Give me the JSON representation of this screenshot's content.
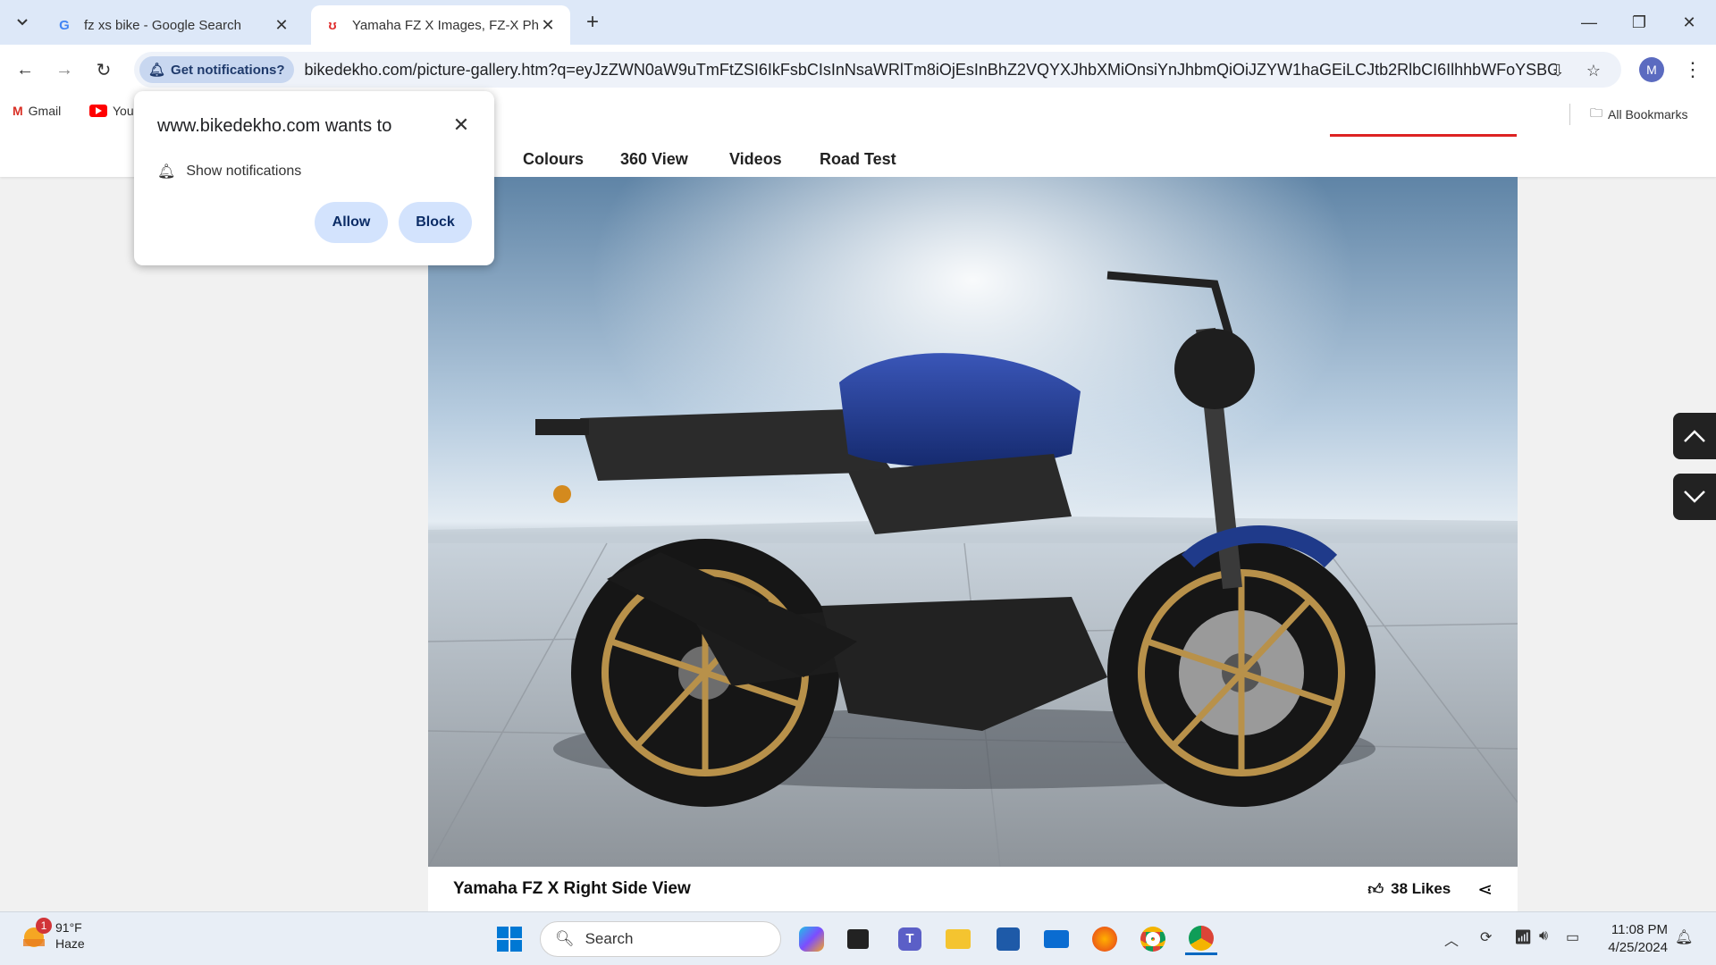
{
  "browser": {
    "tabs": [
      {
        "title": "fz xs bike - Google Search",
        "favicon": "google-icon"
      },
      {
        "title": "Yamaha FZ X Images, FZ-X Phot",
        "favicon": "bikedekho-icon"
      }
    ],
    "notif_chip": "Get notifications?",
    "url": "bikedekho.com/picture-gallery.htm?q=eyJzZWN0aW9uTmFtZSI6IkFsbCIsInNsaWRlTm8iOjEsInBhZ2VQYXJhbXMiOnsiYnJhbmQiOiJZYW1haGEiLCJtb2RlbCI6IlhhbWFoYSBGWiBYIiwidX...",
    "profile_initial": "M",
    "bookmarks": [
      "Gmail",
      "You"
    ],
    "all_bookmarks": "All Bookmarks"
  },
  "page": {
    "subnav": [
      "Colours",
      "360 View",
      "Videos",
      "Road Test"
    ],
    "caption": "Yamaha FZ X Right Side View",
    "likes": "38 Likes"
  },
  "popup": {
    "title": "www.bikedekho.com wants to",
    "permission": "Show notifications",
    "allow": "Allow",
    "block": "Block"
  },
  "taskbar": {
    "temp": "91°F",
    "condition": "Haze",
    "weather_badge": "1",
    "search_placeholder": "Search",
    "time": "11:08 PM",
    "date": "4/25/2024"
  },
  "colors": {
    "accent": "#d3e3fd",
    "tabbar": "#dde8f8",
    "bike_blue": "#1f3a8a",
    "rim_gold": "#b8914a"
  }
}
